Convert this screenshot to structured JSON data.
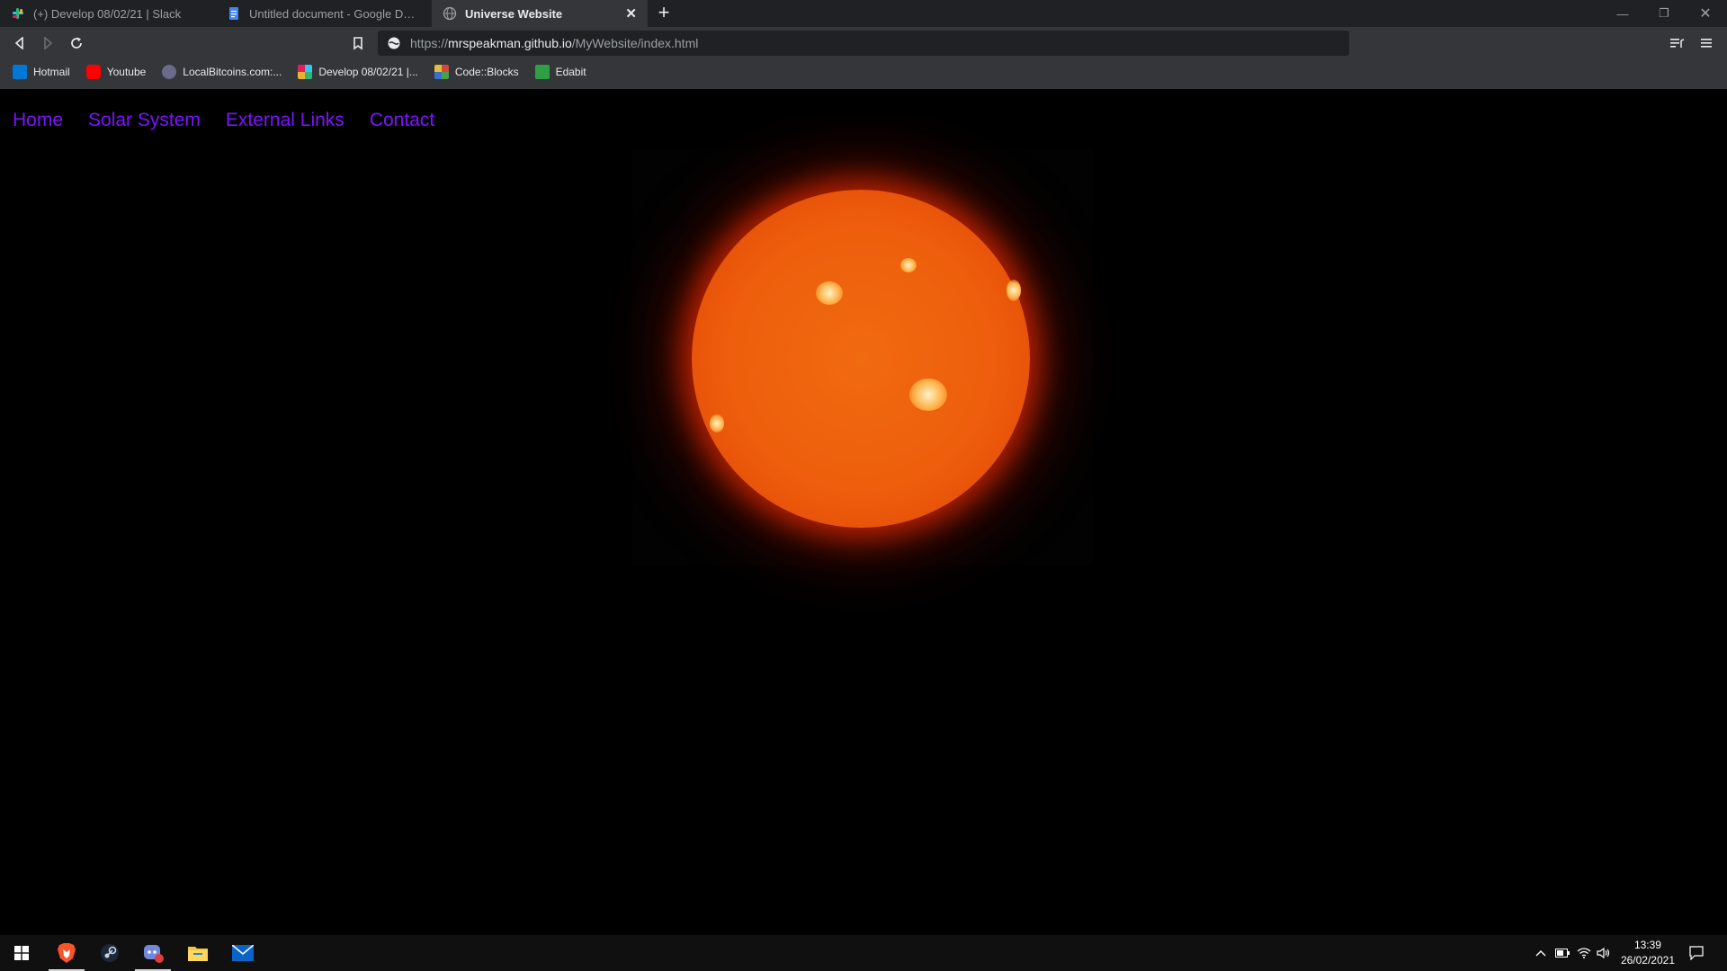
{
  "browser": {
    "tabs": [
      {
        "title": "(+) Develop 08/02/21 | Slack",
        "icon": "slack-icon",
        "active": false
      },
      {
        "title": "Untitled document - Google Docs",
        "icon": "google-docs-icon",
        "active": false
      },
      {
        "title": "Universe Website",
        "icon": "globe-icon",
        "active": true
      }
    ],
    "url": {
      "scheme": "https://",
      "host": "mrspeakman.github.io",
      "path": "/MyWebsite/index.html"
    },
    "bookmarks": [
      {
        "label": "Hotmail",
        "icon": "outlook-icon",
        "color": "#0078d4"
      },
      {
        "label": "Youtube",
        "icon": "youtube-icon",
        "color": "#ff0000"
      },
      {
        "label": "LocalBitcoins.com:...",
        "icon": "localbitcoins-icon",
        "color": "#6a6a8a"
      },
      {
        "label": "Develop 08/02/21 |...",
        "icon": "slack-icon",
        "color": "#e01e5a"
      },
      {
        "label": "Code::Blocks",
        "icon": "codeblocks-icon",
        "color": "#c8a04a"
      },
      {
        "label": "Edabit",
        "icon": "edabit-icon",
        "color": "#2ea043"
      }
    ]
  },
  "site": {
    "nav": [
      "Home",
      "Solar System",
      "External Links",
      "Contact"
    ],
    "link_color": "#7d12ff",
    "hero_image": "sun-image"
  },
  "taskbar": {
    "apps": [
      "windows-start-icon",
      "brave-icon",
      "steam-icon",
      "discord-icon",
      "file-explorer-icon",
      "mail-icon"
    ],
    "time": "13:39",
    "date": "26/02/2021"
  }
}
